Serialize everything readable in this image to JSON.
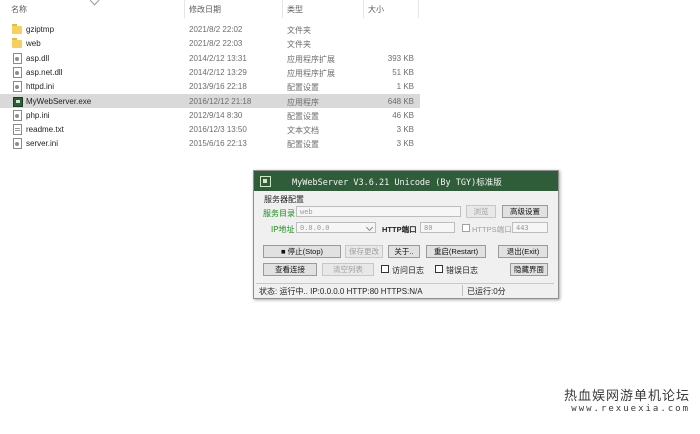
{
  "explorer": {
    "columns": {
      "name": "名称",
      "date": "修改日期",
      "type": "类型",
      "size": "大小"
    },
    "files": [
      {
        "icon": "folder-icon",
        "name": "gziptmp",
        "date": "2021/8/2 22:02",
        "type": "文件夹",
        "size": ""
      },
      {
        "icon": "folder-icon",
        "name": "web",
        "date": "2021/8/2 22:03",
        "type": "文件夹",
        "size": ""
      },
      {
        "icon": "dll-file-icon",
        "name": "asp.dll",
        "date": "2014/2/12 13:31",
        "type": "应用程序扩展",
        "size": "393 KB"
      },
      {
        "icon": "dll-file-icon",
        "name": "asp.net.dll",
        "date": "2014/2/12 13:29",
        "type": "应用程序扩展",
        "size": "51 KB"
      },
      {
        "icon": "ini-file-icon",
        "name": "httpd.ini",
        "date": "2013/9/16 22:18",
        "type": "配置设置",
        "size": "1 KB"
      },
      {
        "icon": "exe-file-icon",
        "name": "MyWebServer.exe",
        "date": "2016/12/12 21:18",
        "type": "应用程序",
        "size": "648 KB",
        "selected": true
      },
      {
        "icon": "ini-file-icon",
        "name": "php.ini",
        "date": "2012/9/14 8:30",
        "type": "配置设置",
        "size": "46 KB"
      },
      {
        "icon": "text-file-icon",
        "name": "readme.txt",
        "date": "2016/12/3 13:50",
        "type": "文本文档",
        "size": "3 KB"
      },
      {
        "icon": "ini-file-icon",
        "name": "server.ini",
        "date": "2015/6/16 22:13",
        "type": "配置设置",
        "size": "3 KB"
      }
    ]
  },
  "dialog": {
    "title": "MyWebServer V3.6.21 Unicode (By TGY)标准版",
    "section": "服务器配置",
    "dir_label": "服务目录",
    "dir_value": "web",
    "browse": "浏览",
    "advanced": "高级设置",
    "ip_label": "IP地址",
    "ip_value": "0.0.0.0",
    "http_port_label": "HTTP端口",
    "http_port_value": "80",
    "https_port_label": "HTTPS端口",
    "https_port_value": "443",
    "stop": "■  停止(Stop)",
    "save_changes": "保存更改",
    "about": "关于..",
    "restart": "重启(Restart)",
    "exit": "退出(Exit)",
    "view_connections": "查看连接",
    "clear_list": "清空列表",
    "access_log": "访问日志",
    "error_log": "错误日志",
    "hide_interface": "隐藏界面",
    "status_text": "状态: 运行中.. IP:0.0.0.0 HTTP:80 HTTPS:N/A",
    "uptime_text": "已运行:0分"
  },
  "watermark": {
    "line1": "热血娱网游单机论坛",
    "line2": "www.rexuexia.com"
  }
}
